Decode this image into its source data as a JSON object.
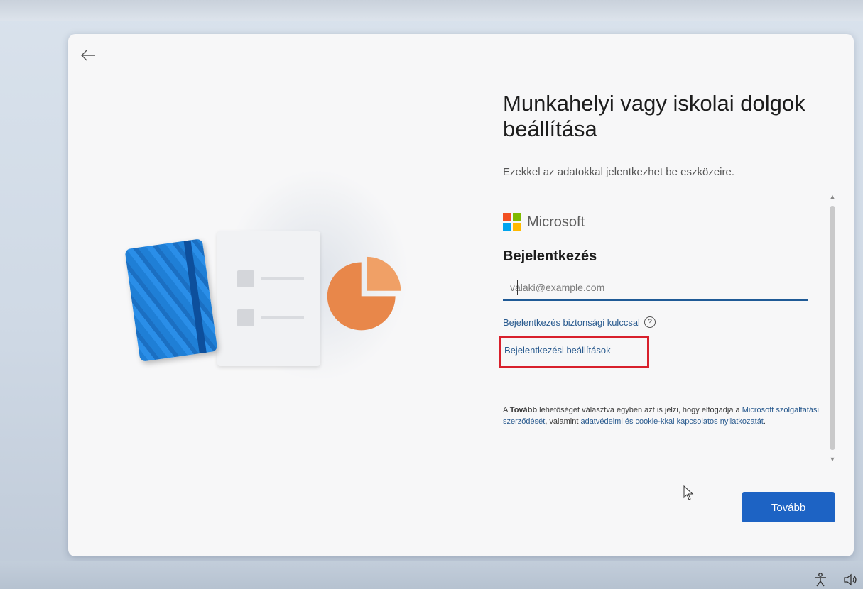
{
  "header": {
    "back_icon": "arrow-left-icon"
  },
  "main": {
    "title": "Munkahelyi vagy iskolai dolgok beállítása",
    "subtitle": "Ezekkel az adatokkal jelentkezhet be eszközeire."
  },
  "signin": {
    "brand": "Microsoft",
    "brand_colors": [
      "#f25022",
      "#7fba00",
      "#00a4ef",
      "#ffb900"
    ],
    "heading": "Bejelentkezés",
    "email_placeholder": "valaki@example.com",
    "email_value": "",
    "security_key_link": "Bejelentkezés biztonsági kulccsal",
    "help_icon_text": "?",
    "options_link": "Bejelentkezési beállítások",
    "terms_prefix": "A ",
    "terms_bold": "Tovább",
    "terms_middle": " lehetőséget választva egyben azt is jelzi, hogy elfogadja a ",
    "terms_link_1": "Microsoft szolgáltatási szerződését",
    "terms_middle_2": ", valamint ",
    "terms_link_2": "adatvédelmi és cookie-kkal kapcsolatos nyilatkozatát",
    "terms_suffix": "."
  },
  "footer": {
    "next_label": "Tovább"
  },
  "colors": {
    "accent": "#1d63c4",
    "link": "#2a5b8f",
    "highlight": "#d8202c"
  },
  "taskbar": {
    "icons": [
      "accessibility-icon",
      "volume-icon"
    ]
  }
}
